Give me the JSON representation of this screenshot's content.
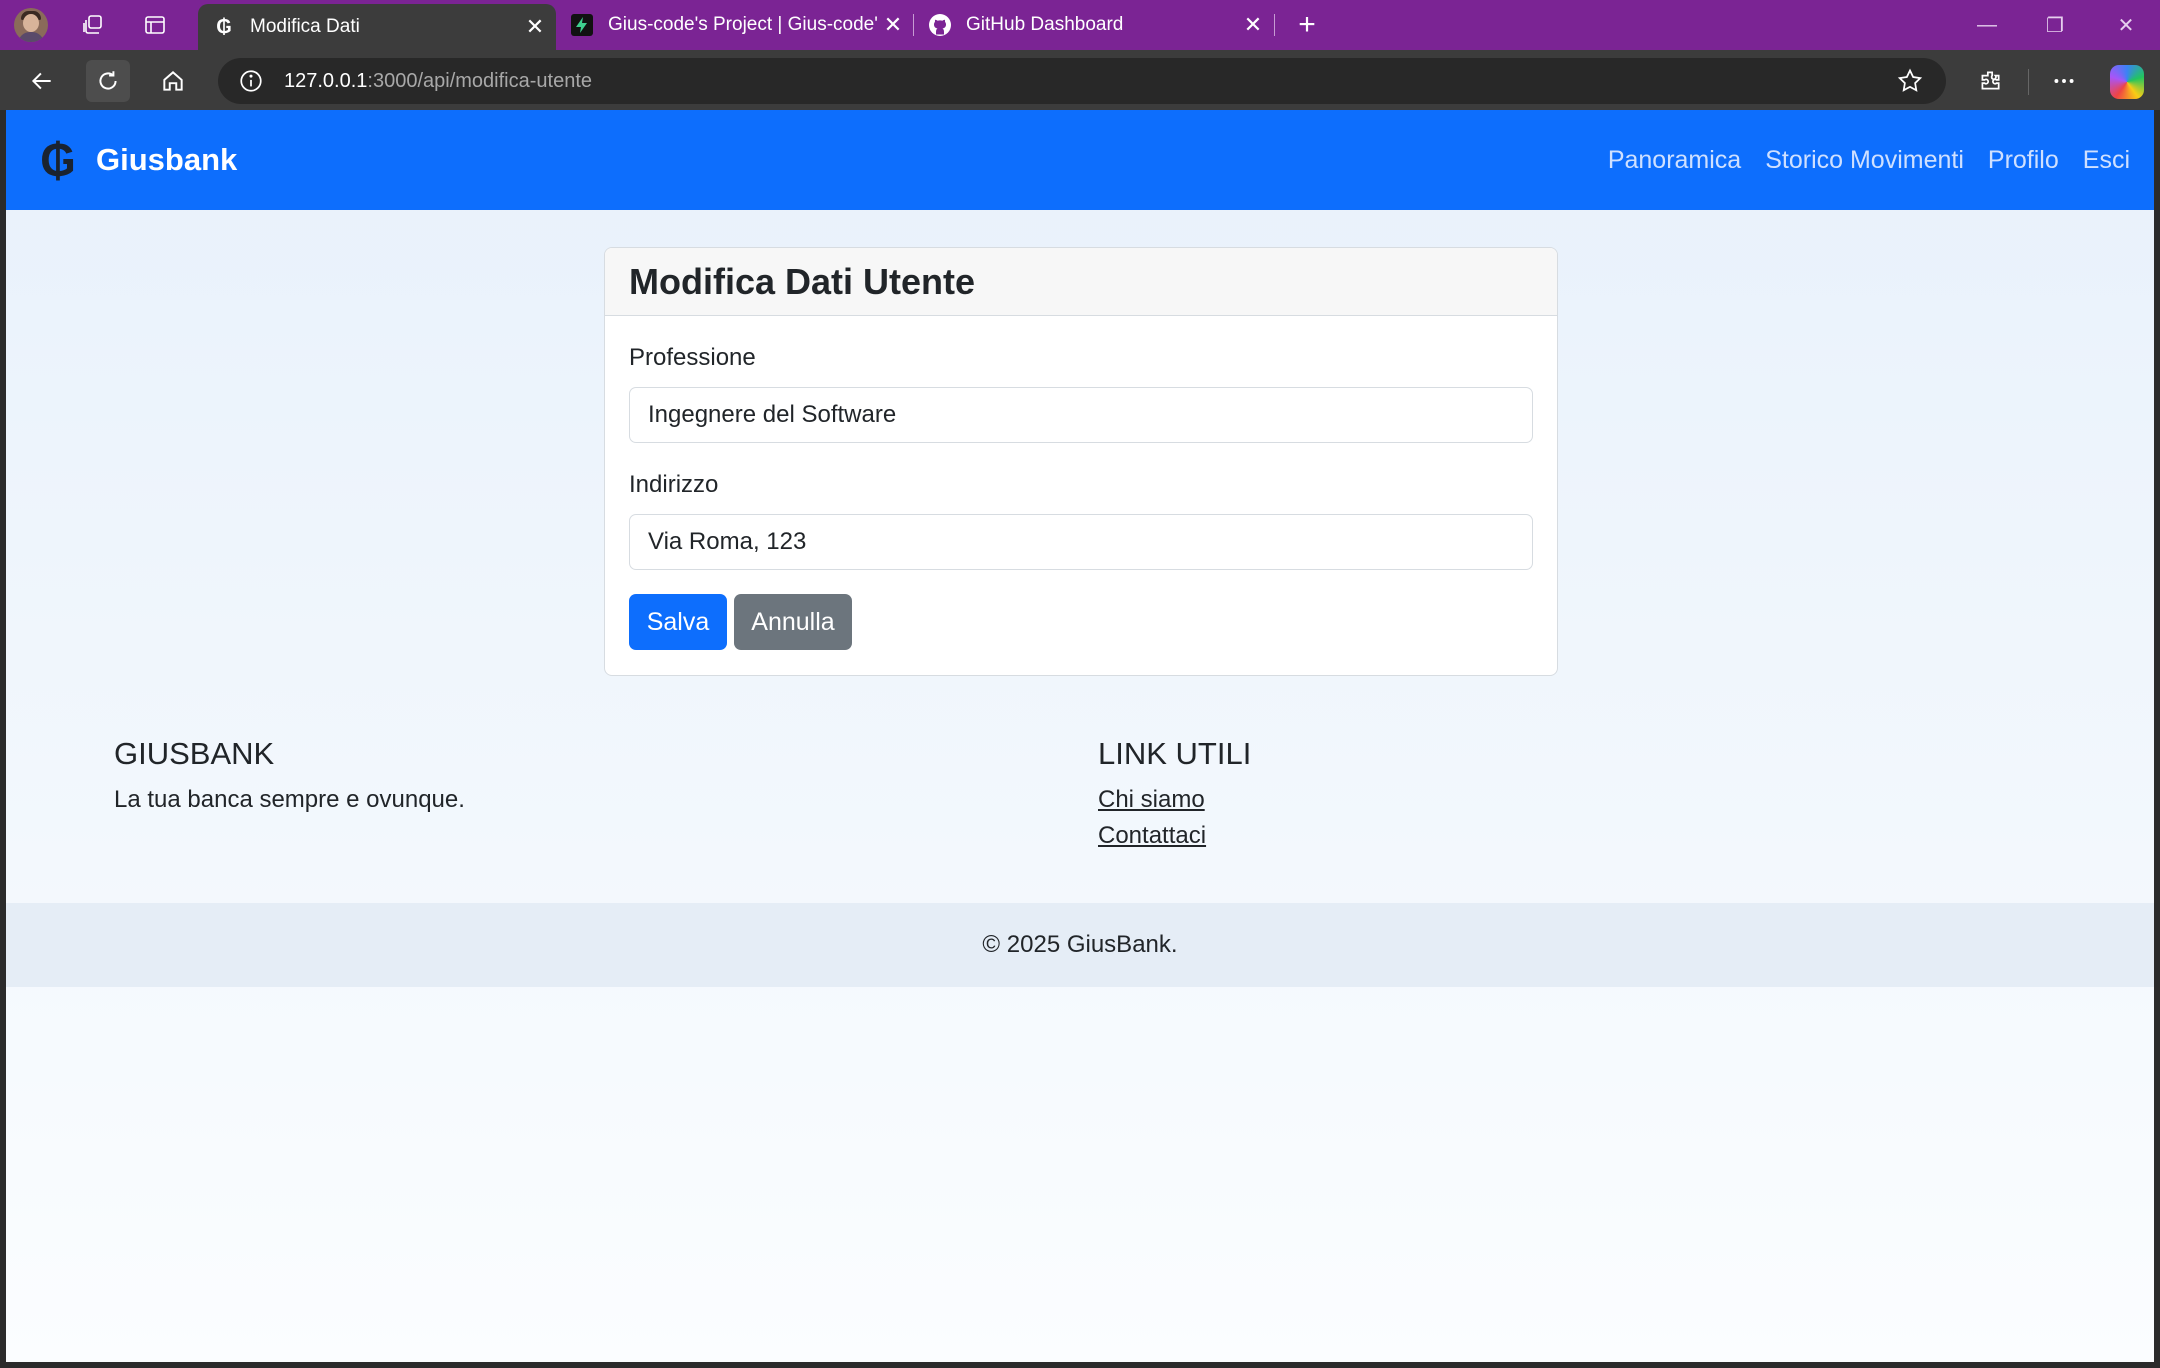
{
  "browser": {
    "tabs": [
      {
        "title": "Modifica Dati",
        "active": true
      },
      {
        "title": "Gius-code's Project | Gius-code's ",
        "active": false
      },
      {
        "title": "GitHub Dashboard",
        "active": false
      }
    ],
    "url": {
      "host": "127.0.0.1",
      "rest": ":3000/api/modifica-utente"
    },
    "icons": [
      "profile-avatar",
      "workspaces-icon",
      "tab-actions-icon",
      "back-icon",
      "reload-icon",
      "home-icon",
      "info-icon",
      "favorite-star-icon",
      "extensions-icon",
      "more-icon",
      "copilot-icon"
    ]
  },
  "navbar": {
    "brand": "Giusbank",
    "brand_symbol": "₲",
    "links": [
      "Panoramica",
      "Storico Movimenti",
      "Profilo",
      "Esci"
    ]
  },
  "form": {
    "title": "Modifica Dati Utente",
    "profession_label": "Professione",
    "profession_value": "Ingegnere del Software",
    "address_label": "Indirizzo",
    "address_value": "Via Roma, 123",
    "save_label": "Salva",
    "cancel_label": "Annulla"
  },
  "footer": {
    "about_title": "GIUSBANK",
    "about_text": "La tua banca sempre e ovunque.",
    "links_title": "LINK UTILI",
    "links": [
      "Chi siamo",
      "Contattaci"
    ],
    "copyright": "© 2025 GiusBank."
  },
  "colors": {
    "tabbar": "#7b2494",
    "navbar": "#0d6efd",
    "primary_button": "#0d6efd",
    "secondary_button": "#6c757d"
  }
}
